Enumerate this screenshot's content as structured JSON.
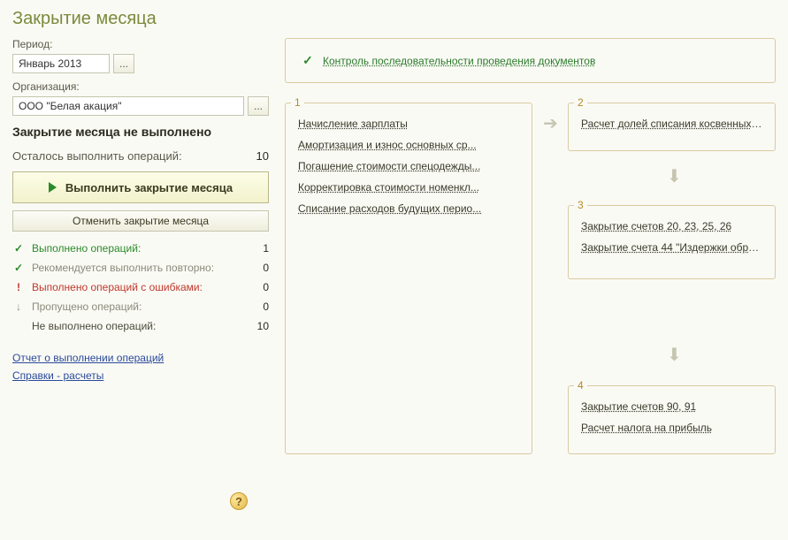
{
  "title": "Закрытие месяца",
  "left": {
    "period_label": "Период:",
    "period_value": "Январь 2013",
    "org_label": "Организация:",
    "org_value": "ООО \"Белая акация\"",
    "status_title": "Закрытие месяца не выполнено",
    "remain_label": "Осталось выполнить операций:",
    "remain_count": "10",
    "run_btn": "Выполнить закрытие месяца",
    "cancel_btn": "Отменить закрытие месяца",
    "stats": {
      "done_label": "Выполнено операций:",
      "done_count": "1",
      "redo_label": "Рекомендуется выполнить повторно:",
      "redo_count": "0",
      "err_label": "Выполнено операций с ошибками:",
      "err_count": "0",
      "skip_label": "Пропущено операций:",
      "skip_count": "0",
      "nodo_label": "Не выполнено операций:",
      "nodo_count": "10"
    },
    "report_link": "Отчет о выполнении операций",
    "refs_link": "Справки - расчеты"
  },
  "right": {
    "control_link": "Контроль последовательности проведения документов",
    "g1": {
      "num": "1",
      "items": [
        "Начисление зарплаты",
        "Амортизация и износ основных ср...",
        "Погашение стоимости спецодежды...",
        "Корректировка стоимости номенкл...",
        "Списание расходов будущих перио..."
      ]
    },
    "g2": {
      "num": "2",
      "items": [
        "Расчет долей списания косвенных ..."
      ]
    },
    "g3": {
      "num": "3",
      "items": [
        "Закрытие счетов 20, 23, 25, 26",
        "Закрытие счета 44 \"Издержки обра..."
      ]
    },
    "g4": {
      "num": "4",
      "items": [
        "Закрытие счетов 90, 91",
        "Расчет налога на прибыль"
      ]
    }
  }
}
